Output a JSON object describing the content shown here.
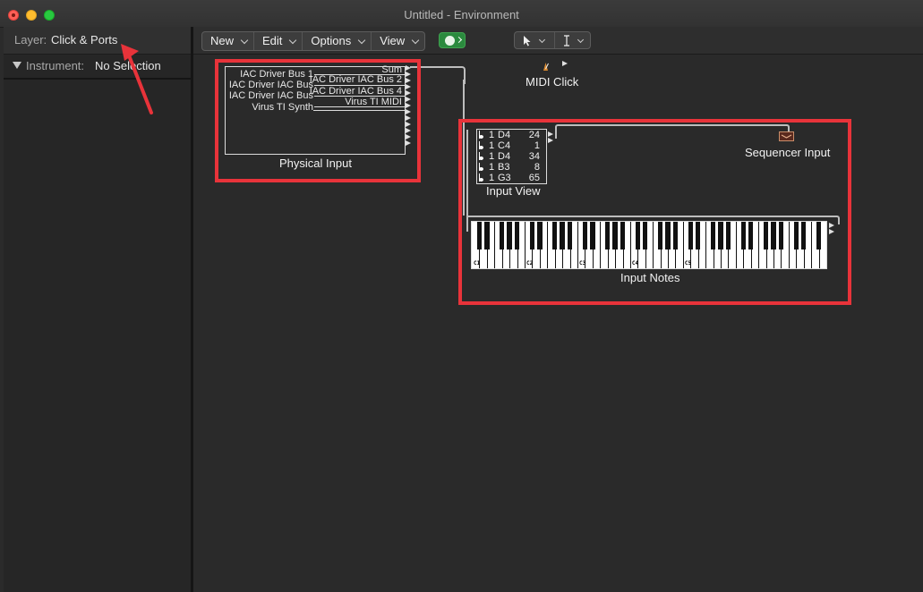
{
  "window": {
    "title": "Untitled - Environment"
  },
  "inspector": {
    "layer_label": "Layer:",
    "layer_value": "Click & Ports",
    "instrument_label": "Instrument:",
    "instrument_value": "No Selection"
  },
  "toolbar": {
    "menus": [
      "New",
      "Edit",
      "Options",
      "View"
    ]
  },
  "objects": {
    "physical_input": {
      "label": "Physical Input",
      "left_ports": [
        "IAC Driver Bus 1",
        "IAC Driver IAC Bus",
        "IAC Driver IAC Bus",
        "Virus TI Synth"
      ],
      "right_ports": [
        "Sum",
        "IAC Driver IAC Bus 2",
        "IAC Driver IAC Bus 4",
        "Virus TI MIDI"
      ]
    },
    "midi_click": {
      "label": "MIDI Click"
    },
    "input_view": {
      "label": "Input View",
      "rows": [
        {
          "channel": "1",
          "note": "D4",
          "value": "24"
        },
        {
          "channel": "1",
          "note": "C4",
          "value": "1"
        },
        {
          "channel": "1",
          "note": "D4",
          "value": "34"
        },
        {
          "channel": "1",
          "note": "B3",
          "value": "8"
        },
        {
          "channel": "1",
          "note": "G3",
          "value": "65"
        }
      ]
    },
    "sequencer_input": {
      "label": "Sequencer Input"
    },
    "input_notes": {
      "label": "Input Notes",
      "octave_labels": [
        "C1",
        "C2",
        "C3",
        "C4",
        "C5"
      ]
    }
  },
  "colors": {
    "highlight": "#e8333a",
    "midi_button": "#2b8a3e",
    "annotation_arrow": "#e8333a"
  }
}
